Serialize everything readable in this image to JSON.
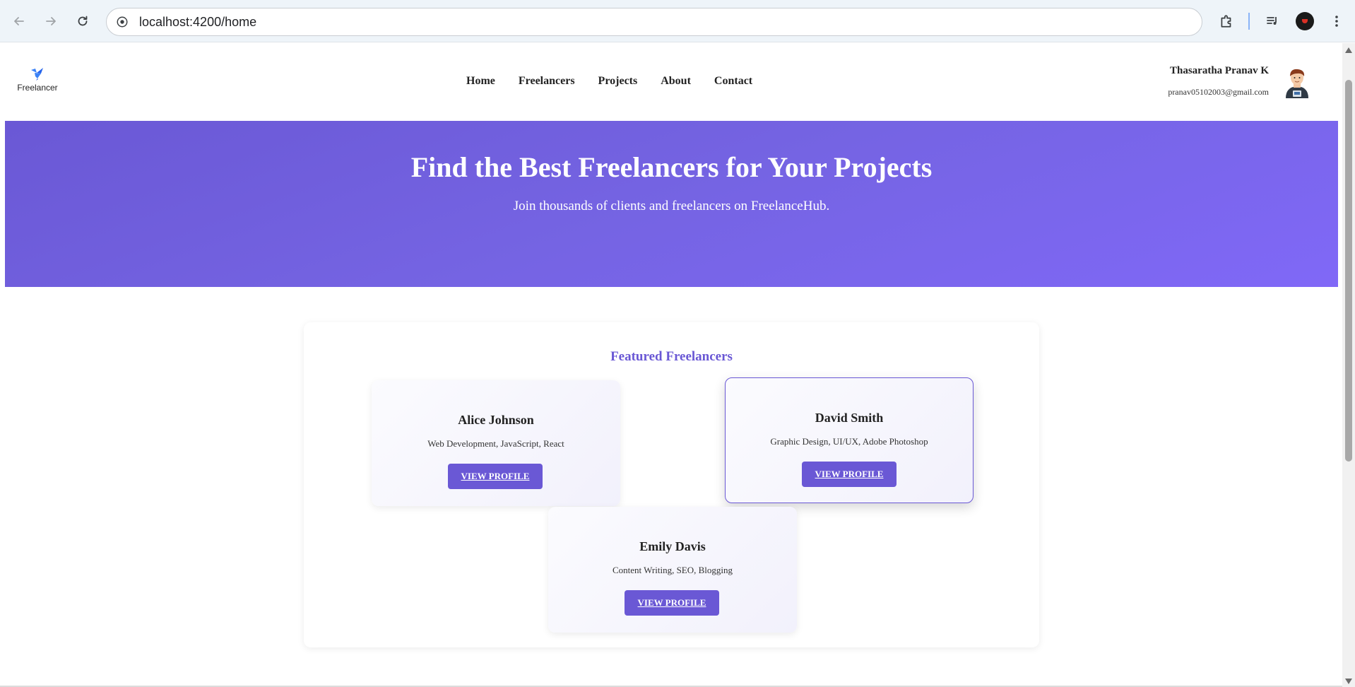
{
  "browser": {
    "url": "localhost:4200/home",
    "icons": [
      "back-icon",
      "forward-icon",
      "reload-icon",
      "site-info-icon",
      "extensions-icon",
      "media-icon",
      "profile-icon",
      "menu-icon"
    ]
  },
  "site": {
    "logo_text": "Freelancer",
    "nav": [
      {
        "label": "Home"
      },
      {
        "label": "Freelancers"
      },
      {
        "label": "Projects"
      },
      {
        "label": "About"
      },
      {
        "label": "Contact"
      }
    ],
    "user": {
      "name": "Thasaratha Pranav K",
      "email": "pranav05102003@gmail.com"
    }
  },
  "hero": {
    "title": "Find the Best Freelancers for Your Projects",
    "subtitle": "Join thousands of clients and freelancers on FreelanceHub."
  },
  "featured": {
    "title": "Featured Freelancers",
    "cards": [
      {
        "name": "Alice Johnson",
        "skills": "Web Development, JavaScript, React",
        "button": "VIEW PROFILE"
      },
      {
        "name": "David Smith",
        "skills": "Graphic Design, UI/UX, Adobe Photoshop",
        "button": "VIEW PROFILE"
      },
      {
        "name": "Emily Davis",
        "skills": "Content Writing, SEO, Blogging",
        "button": "VIEW PROFILE"
      }
    ]
  },
  "colors": {
    "accent": "#6a58d5",
    "hero_start": "#6a58d5",
    "hero_end": "#8068f7",
    "logo_blue": "#3b82f6"
  }
}
